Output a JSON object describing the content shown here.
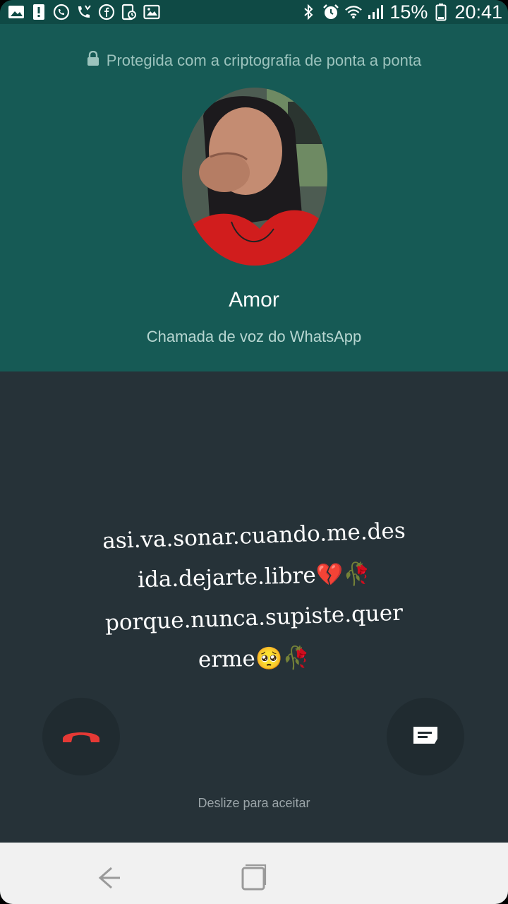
{
  "status_bar": {
    "battery_percent": "15%",
    "time": "20:41",
    "left_icons": [
      "image-icon",
      "alert-icon",
      "whatsapp-icon",
      "missed-call-icon",
      "facebook-icon",
      "phone-note-icon",
      "gallery-icon"
    ],
    "right_icons": [
      "bluetooth-icon",
      "alarm-icon",
      "wifi-icon",
      "signal-icon",
      "battery-icon"
    ]
  },
  "call": {
    "encryption_text": "Protegida com a criptografia de ponta a ponta",
    "caller_name": "Amor",
    "call_type": "Chamada de voz do WhatsApp",
    "swipe_hint": "Deslize para aceitar"
  },
  "caption": {
    "line1": "asi.va.sonar.cuando.me.des",
    "line2": "ida.dejarte.libre",
    "line2_emoji_1": "💔",
    "line2_emoji_2": "🥀",
    "line3": "porque.nunca.supiste.quer",
    "line4": "erme",
    "line4_emoji_1": "🥺",
    "line4_emoji_2": "🥀"
  },
  "colors": {
    "header": "#165a55",
    "status_bar": "#0f4a45",
    "body": "#263238",
    "decline": "#e53935",
    "nav_bar": "#f1f1f1"
  },
  "icons": {
    "lock": "lock-icon",
    "decline": "phone-hangup-icon",
    "message": "message-icon",
    "nav_back": "back-icon",
    "nav_home": "recents-icon"
  }
}
